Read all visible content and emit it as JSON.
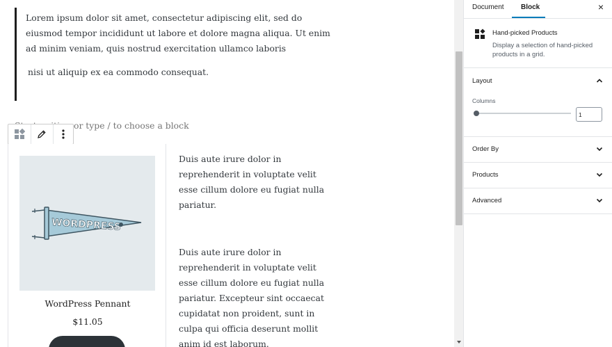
{
  "editor": {
    "quote_paragraph_1": "Lorem ipsum dolor sit amet, consectetur adipiscing elit, sed do eiusmod tempor incididunt ut labore et dolore magna aliqua. Ut enim ad minim veniam, quis nostrud exercitation ullamco laboris",
    "quote_paragraph_2": "nisi ut aliquip ex ea commodo consequat.",
    "placeholder": "Start writing or type / to choose a block",
    "product": {
      "title": "WordPress Pennant",
      "price": "$11.05",
      "image_text": "WORDPRESS"
    },
    "side_text_1": "Duis aute irure dolor in reprehenderit in voluptate velit esse cillum dolore eu fugiat nulla pariatur.",
    "side_text_2": "Duis aute irure dolor in reprehenderit in voluptate velit esse cillum dolore eu fugiat nulla pariatur. Excepteur sint occaecat cupidatat non proident, sunt in culpa qui officia deserunt mollit anim id est laborum."
  },
  "toolbar": {
    "icons": [
      "block-type-icon",
      "edit-icon",
      "more-options-icon"
    ]
  },
  "sidebar": {
    "tabs": [
      {
        "label": "Document"
      },
      {
        "label": "Block"
      }
    ],
    "active_tab": "Block",
    "close_label": "×",
    "block": {
      "name": "Hand-picked Products",
      "description": "Display a selection of hand-picked products in a grid."
    },
    "panels": {
      "layout": {
        "title": "Layout",
        "columns_label": "Columns",
        "columns_value": "1"
      },
      "order_by": {
        "title": "Order By"
      },
      "products": {
        "title": "Products"
      },
      "advanced": {
        "title": "Advanced"
      }
    }
  },
  "colors": {
    "accent": "#007cba",
    "text": "#1e1e1e",
    "muted": "#555d66",
    "image_bg": "#e4eaed",
    "pennant": "#a6cad9",
    "button": "#2c3338"
  }
}
